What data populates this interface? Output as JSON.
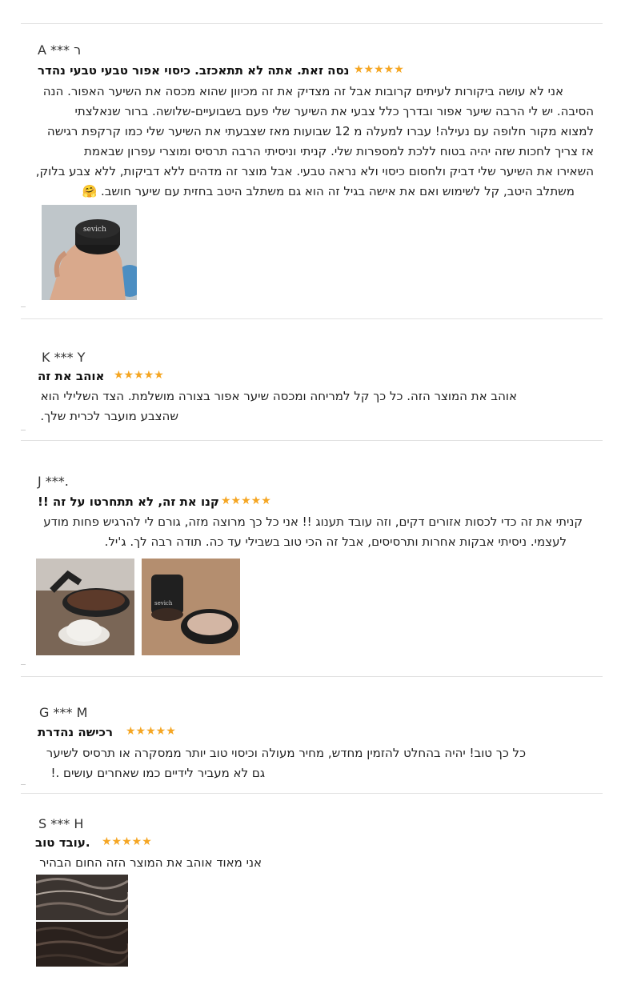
{
  "reviews": [
    {
      "author": "A *** ר",
      "title": "נסה זאת. אתה לא תתאכזב. כיסוי אפור טבעי טבעי נהדר",
      "stars": "★★★★★",
      "lines": [
        "אני לא עושה ביקורות לעיתים קרובות אבל זה מצדיק את זה מכיוון שהוא מכסה את השיער האפור. הנה",
        "הסיבה. יש לי הרבה שיער אפור ובדרך כלל צבעי את השיער שלי פעם בשבועיים-שלושה. ברור שנאלצתי",
        "למצוא מקור חלופה עם נעילה! עברו למעלה מ 12 שבועות מאז שצבעתי את השיער שלי כמו קרקפת רגישה",
        "אז צריך לחכות שזה יהיה בטוח ללכת למספרות שלי. קניתי וניסיתי הרבה תרסיס ומוצרי עפרון שבאמת",
        "השאירו את השיער שלי דביק ולחסום כיסוי ולא נראה טבעי. אבל מוצר זה מדהים ללא דביקות, ללא צבע בלוק,",
        "משתלב היטב, קל לשימוש ואם את אישה בגיל זה הוא גם משתלב היטב בחזית עם שיער חושב. 🤗"
      ]
    },
    {
      "author": "K *** Y",
      "title": "אוהב את זה",
      "stars": "★★★★★",
      "lines": [
        "אוהב את המוצר הזה. כל כך קל למריחה ומכסה שיער אפור בצורה מושלמת. הצד השלילי הוא",
        "שהצבע מועבר לכרית שלך."
      ]
    },
    {
      "author": "J ***.",
      "title": "!! קנו את זה, לא תתחרטו על זה",
      "stars": "★★★★★",
      "lines": [
        "קניתי את זה כדי לכסות אזורים דקים, וזה עובד תענוג !! אני כל כך מרוצה מזה, גורם לי להרגיש פחות מודע",
        "לעצמי. ניסיתי אבקות אחרות ותרסיסים, אבל זה הכי טוב בשבילי עד כה. תודה רבה לך. ג'יל."
      ]
    },
    {
      "author": "G *** M",
      "title": "רכישה נהדרת",
      "stars": "★★★★★",
      "lines": [
        "כל כך טוב! יהיה בהחלט להזמין מחדש, מחיר מעולה וכיסוי טוב יותר ממסקרה או תרסיס לשיער",
        "גם לא מעביר לידיים כמו שאחרים עושים .!"
      ]
    },
    {
      "author": "S *** H",
      "title": "עובד טוב.",
      "stars": "★★★★★",
      "lines": [
        "אני מאוד אוהב את המוצר הזה החום הבהיר"
      ]
    }
  ]
}
